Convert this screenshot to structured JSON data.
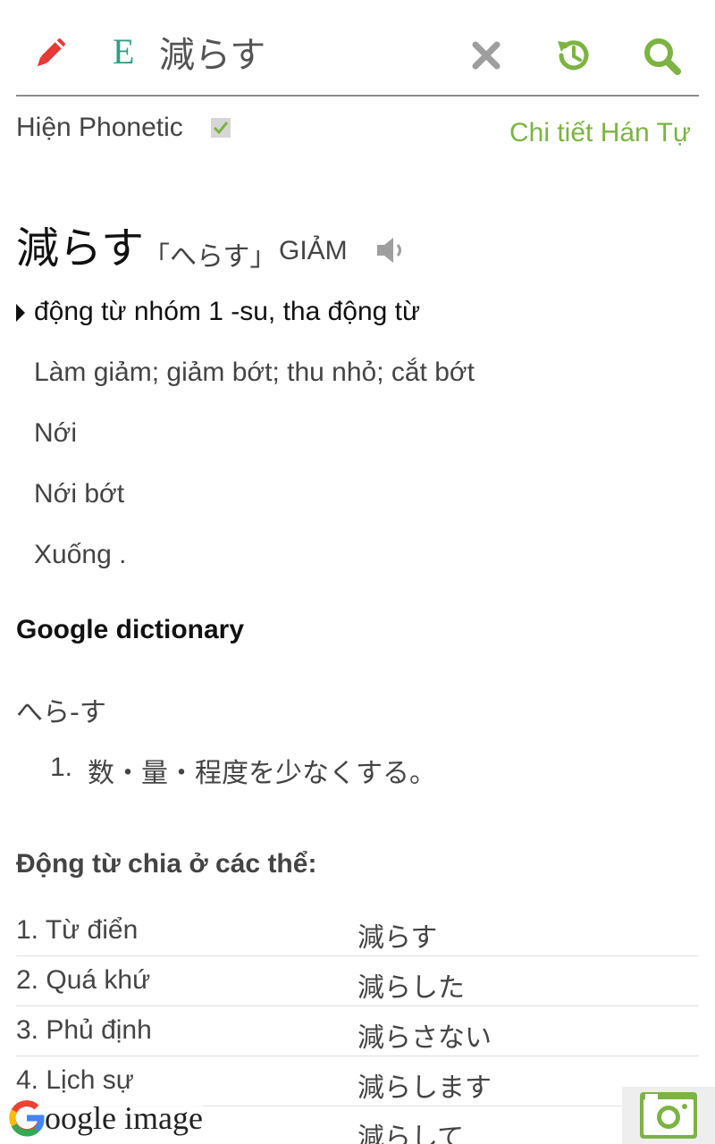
{
  "search": {
    "language_badge": "E",
    "query": "減らす"
  },
  "icons": {
    "edit": "pencil-icon",
    "clear": "close-icon",
    "history": "history-icon",
    "search": "search-icon",
    "speaker": "speaker-icon",
    "google": "google-g-icon",
    "camera": "camera-icon"
  },
  "colors": {
    "accent_green": "#7cb342",
    "badge_teal": "#2f9e83",
    "pencil_red": "#e53935",
    "clear_gray": "#9e9e9e"
  },
  "phonetic": {
    "label": "Hiện Phonetic",
    "checked": true
  },
  "kanji_detail_link": "Chi tiết Hán Tự",
  "entry": {
    "headword": "減らす",
    "reading": "「へらす」",
    "han_viet": "GIẢM",
    "part_of_speech": "động từ nhóm 1 -su, tha động từ",
    "meanings": [
      "Làm giảm; giảm bớt; thu nhỏ; cắt bớt",
      "Nới",
      "Nới bớt",
      "Xuống ."
    ]
  },
  "google_dictionary": {
    "title": "Google dictionary",
    "reading": "へら-す",
    "definitions": [
      {
        "num": "1.",
        "text": "数・量・程度を少なくする。"
      }
    ]
  },
  "conjugation": {
    "title": "Động từ chia ở các thể:",
    "rows": [
      {
        "label": "1. Từ điển",
        "value": "減らす"
      },
      {
        "label": "2. Quá khứ",
        "value": "減らした"
      },
      {
        "label": "3. Phủ định",
        "value": "減らさない"
      },
      {
        "label": "4. Lịch sự",
        "value": "減らします"
      },
      {
        "label": "",
        "value": "減らして"
      }
    ]
  },
  "google_image": {
    "label_rest": "oogle image"
  }
}
